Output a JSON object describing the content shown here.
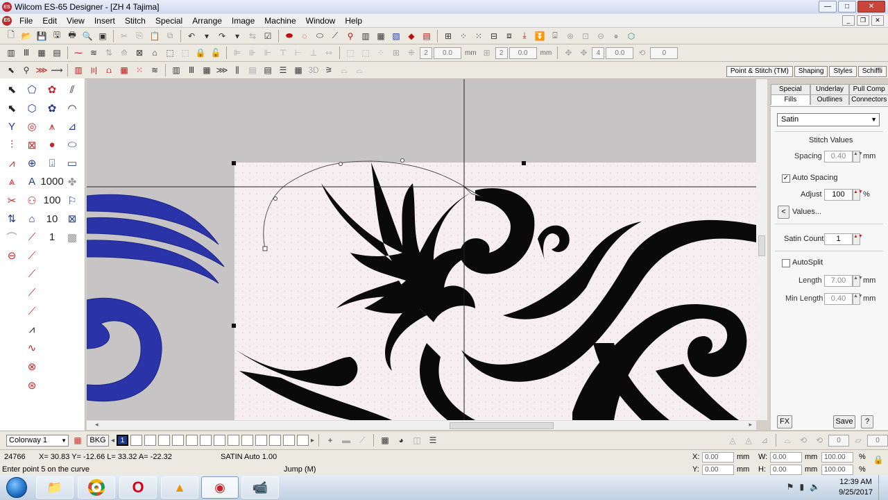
{
  "window": {
    "title": "Wilcom ES-65 Designer - [ZH 4         Tajima]",
    "min": "—",
    "max": "□",
    "close": "✕",
    "mdi_min": "_",
    "mdi_restore": "❐",
    "mdi_close": "✕"
  },
  "menu": [
    "File",
    "Edit",
    "View",
    "Insert",
    "Stitch",
    "Special",
    "Arrange",
    "Image",
    "Machine",
    "Window",
    "Help"
  ],
  "toolbar2": {
    "n1": "2",
    "v1": "0.0",
    "u1": "mm",
    "n2": "2",
    "v2": "0.0",
    "u2": "mm",
    "n3": "4",
    "v3": "0.0",
    "n4": "0"
  },
  "toolbar3": {
    "label_3d": "3D"
  },
  "top_tabs": [
    "Point & Stitch (TM)",
    "Shaping",
    "Styles",
    "Schiffli"
  ],
  "right_panel": {
    "tabs_row1": [
      "Special",
      "Underlay",
      "Pull Comp"
    ],
    "tabs_row2": [
      "Fills",
      "Outlines",
      "Connectors"
    ],
    "stitch_type": "Satin",
    "stitch_values_label": "Stitch Values",
    "spacing_label": "Spacing",
    "spacing_value": "0.40",
    "spacing_unit": "mm",
    "auto_spacing_label": "Auto Spacing",
    "auto_spacing_checked": true,
    "adjust_label": "Adjust",
    "adjust_value": "100",
    "adjust_unit": "%",
    "values_btn": "Values...",
    "values_arrow": "<",
    "satin_count_label": "Satin Count",
    "satin_count_value": "1",
    "autosplit_label": "AutoSplit",
    "autosplit_checked": false,
    "length_label": "Length",
    "length_value": "7.00",
    "length_unit": "mm",
    "min_length_label": "Min Length",
    "min_length_value": "0.40",
    "min_length_unit": "mm",
    "fx_btn": "FX",
    "save_btn": "Save",
    "help_btn": "?"
  },
  "colorbar": {
    "colorway": "Colorway 1",
    "bkg": "BKG",
    "selected_swatch": "1",
    "nav_prev": "◂",
    "nav_next": "▸",
    "spin1": "0",
    "spin2": "0"
  },
  "status": {
    "stitch_count": "24766",
    "coords": "X=  30.83 Y= -12.66 L=   33.32 A= -22.32",
    "mode": "SATIN Auto  1.00",
    "prompt": "Enter point 5 on the curve",
    "jump": "Jump (M)",
    "x_label": "X:",
    "x_value": "0.00",
    "y_label": "Y:",
    "y_value": "0.00",
    "w_label": "W:",
    "w_value": "0.00",
    "h_label": "H:",
    "h_value": "0.00",
    "unit_mm": "mm",
    "w_pct": "100.00",
    "h_pct": "100.00",
    "pct": "%"
  },
  "taskbar": {
    "time": "12:39 AM",
    "date": "9/25/2017"
  },
  "colors": {
    "thread_blue": "#2a33a8",
    "design_black": "#0a0a0a",
    "hoop_bg": "#f7eef2",
    "canvas_gray": "#c7c4c6"
  }
}
